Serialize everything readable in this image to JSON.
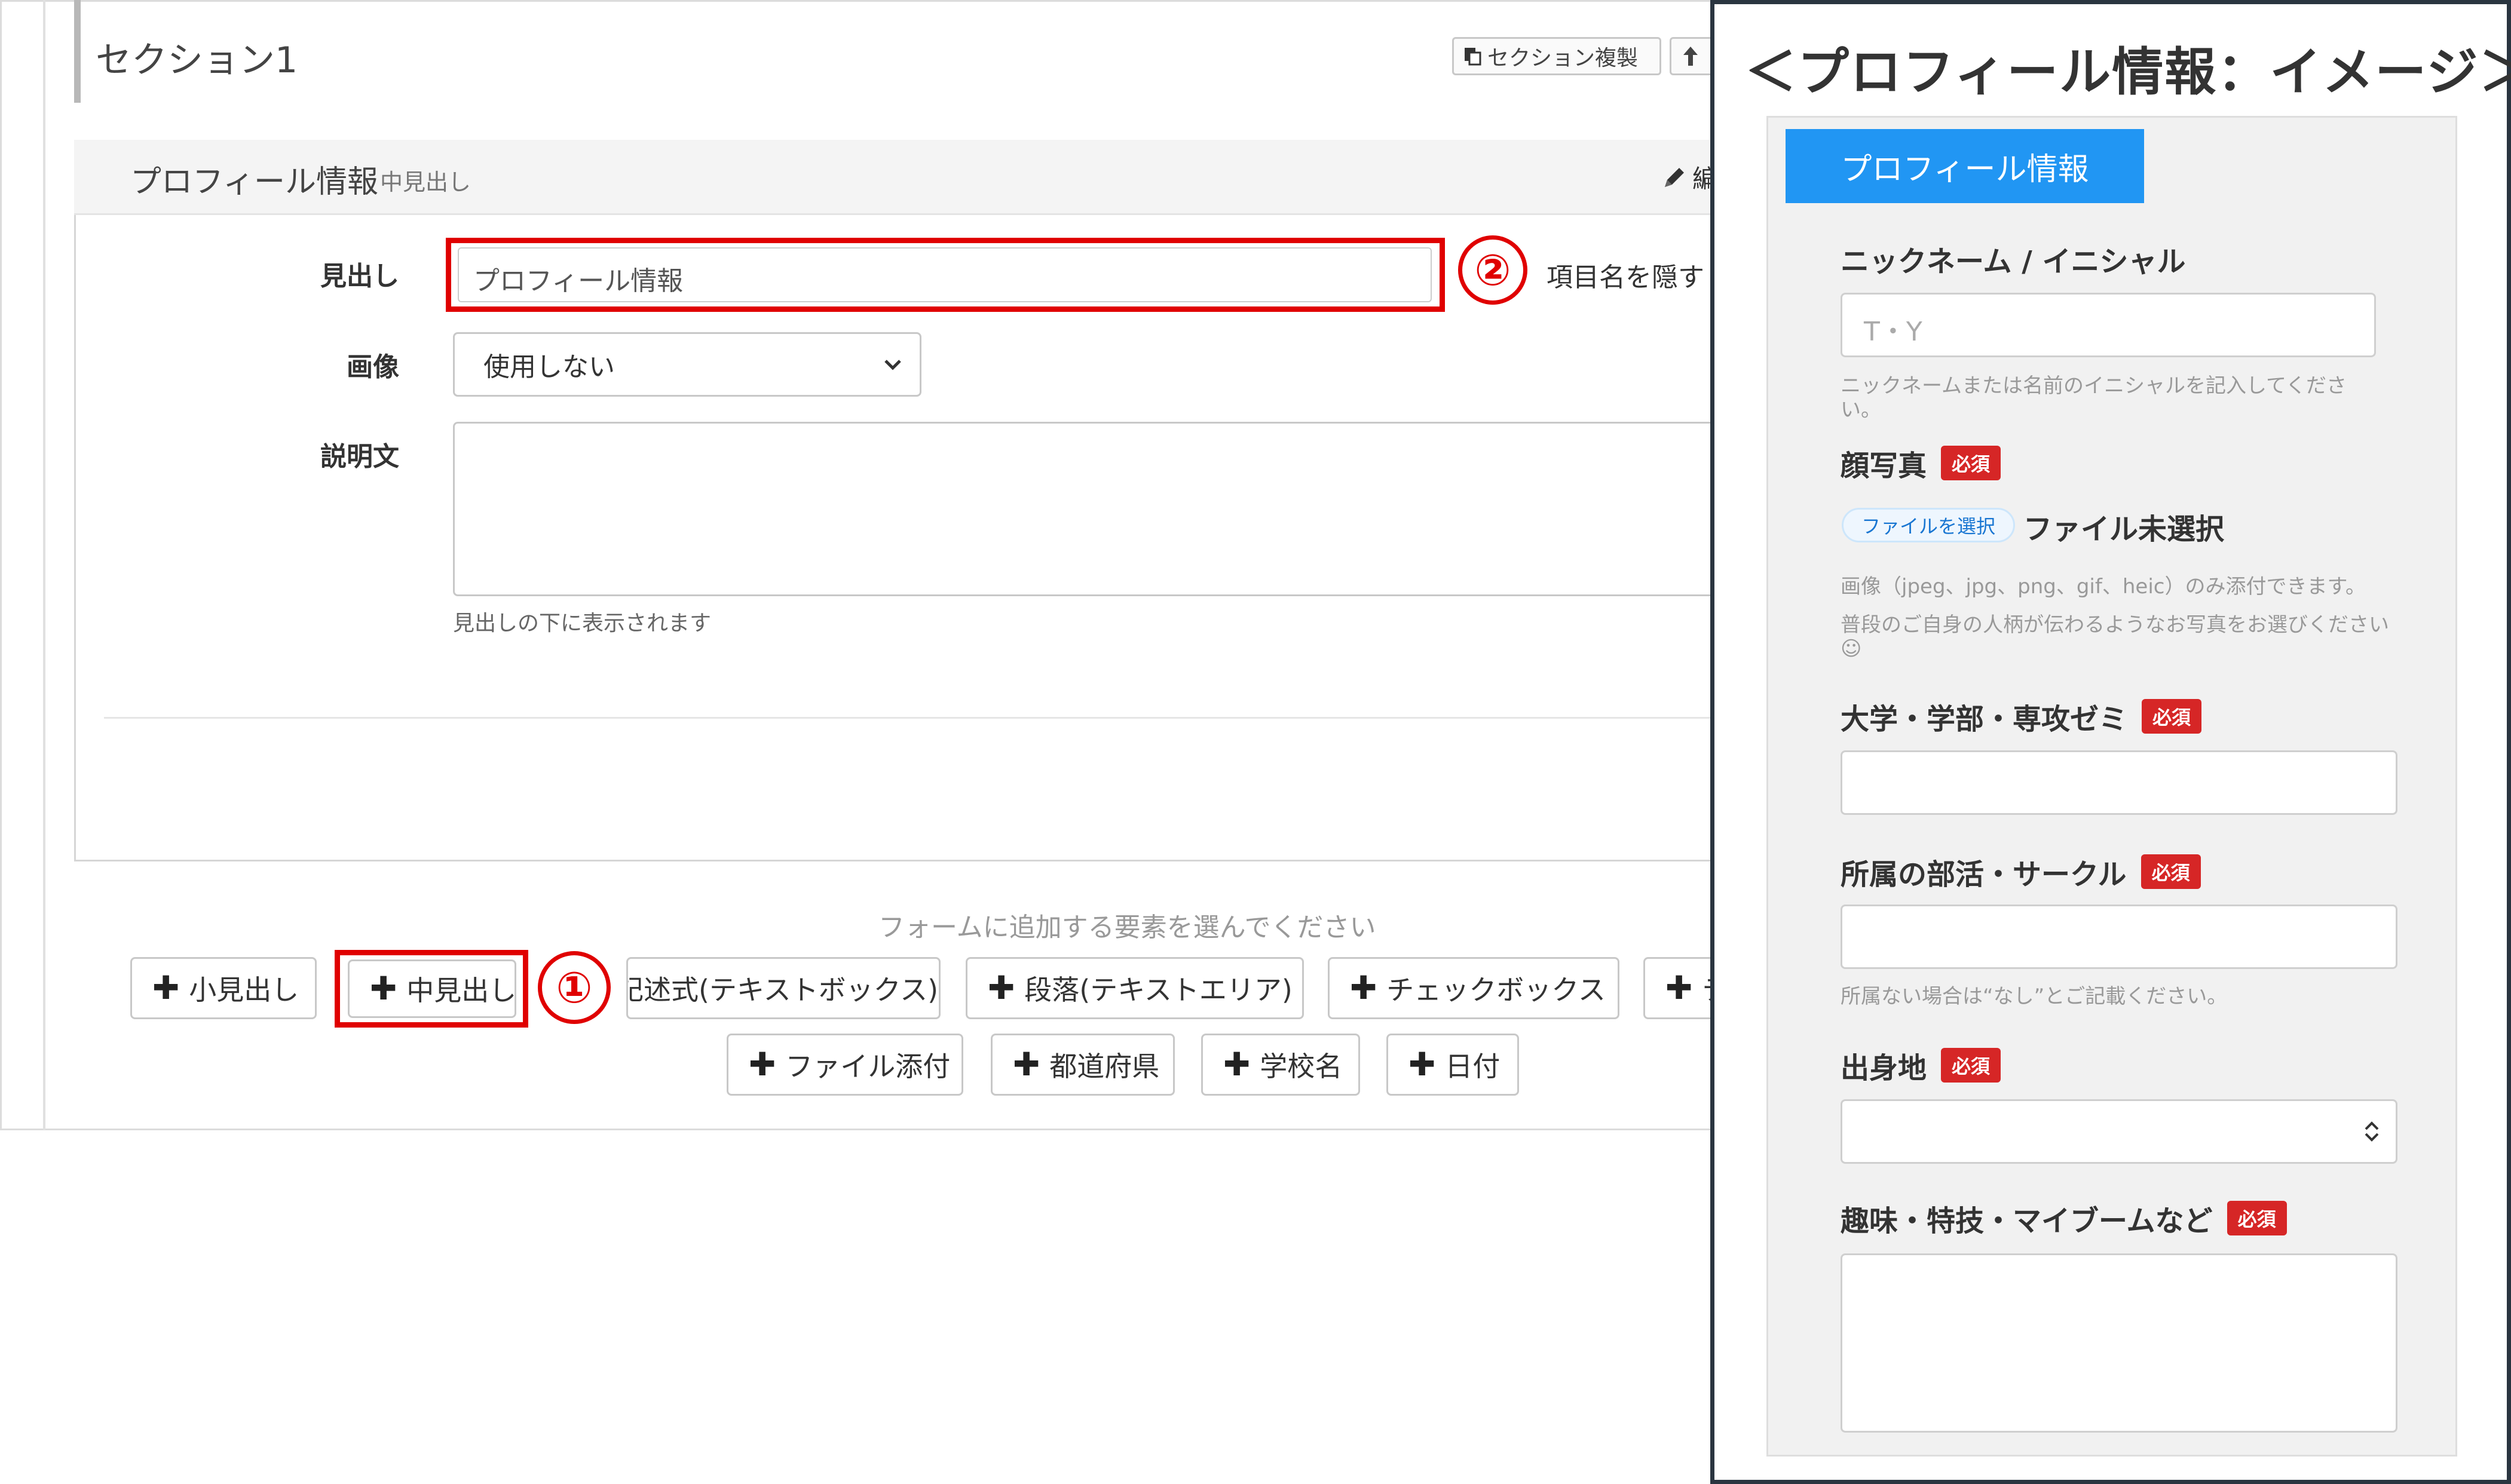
{
  "editor": {
    "section_title": "セクション1",
    "duplicate_button": "セクション複製",
    "card": {
      "title": "プロフィール情報",
      "type_label": "中見出し",
      "edit_label": "編"
    },
    "fields": {
      "heading_label": "見出し",
      "heading_value": "プロフィール情報",
      "hide_item_label": "項目名を隠す",
      "image_label": "画像",
      "image_select_value": "使用しない",
      "description_label": "説明文",
      "description_help": "見出しの下に表示されます"
    },
    "add_prompt": "フォームに追加する要素を選んでください",
    "add_buttons": [
      "小見出し",
      "中見出し",
      "記述式(テキストボックス)",
      "段落(テキストエリア)",
      "チェックボックス",
      "テ",
      "ファイル添付",
      "都道府県",
      "学校名",
      "日付"
    ],
    "step1": "①",
    "step2": "②"
  },
  "preview": {
    "title": "＜プロフィール情報：イメージ＞",
    "tab_label": "プロフィール情報",
    "required_badge": "必須",
    "fields": {
      "nickname_label": "ニックネーム / イニシャル",
      "nickname_placeholder": "T・Y",
      "nickname_help": "ニックネームまたは名前のイニシャルを記入してください。",
      "photo_label": "顔写真",
      "file_button": "ファイルを選択",
      "file_status": "ファイル未選択",
      "photo_help1": "画像（jpeg、jpg、png、gif、heic）のみ添付できます。",
      "photo_help2": "普段のご自身の人柄が伝わるようなお写真をお選びください☺",
      "university_label": "大学・学部・専攻ゼミ",
      "club_label": "所属の部活・サークル",
      "club_help": "所属ない場合は“なし”とご記載ください。",
      "hometown_label": "出身地",
      "hobby_label": "趣味・特技・マイブームなど"
    }
  },
  "colors": {
    "highlight_red": "#e00000",
    "primary_blue": "#2196f3",
    "required_red": "#d62626"
  }
}
